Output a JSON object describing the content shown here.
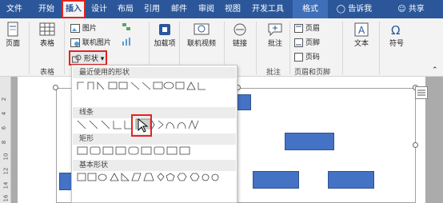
{
  "tabs": [
    "文件",
    "开始",
    "插入",
    "设计",
    "布局",
    "引用",
    "邮件",
    "审阅",
    "视图",
    "开发工具",
    "格式"
  ],
  "tell_me": "告诉我",
  "share": "共享",
  "ribbon": {
    "pages_label": "页面",
    "table_label": "表格",
    "table_group_label": "表格",
    "picture_label": "图片",
    "online_picture_label": "联机图片",
    "shapes_label": "形状",
    "addin_label": "加载项",
    "online_video_label": "联机视频",
    "link_label": "链接",
    "comment_label": "批注",
    "comment_group_label": "批注",
    "header_label": "页眉",
    "footer_label": "页脚",
    "page_number_label": "页码",
    "header_footer_group_label": "页眉和页脚",
    "text_label": "文本",
    "symbol_label": "符号"
  },
  "shapes_panel": {
    "recent_title": "最近使用的形状",
    "lines_title": "线条",
    "rect_title": "矩形",
    "basic_title": "基本形状"
  },
  "ruler_numbers": [
    "2",
    "4",
    "6",
    "8",
    "10",
    "12",
    "14",
    "16"
  ],
  "accent": "#2b579a",
  "highlight": "#e4231f",
  "shape_fill": "#4472c4"
}
